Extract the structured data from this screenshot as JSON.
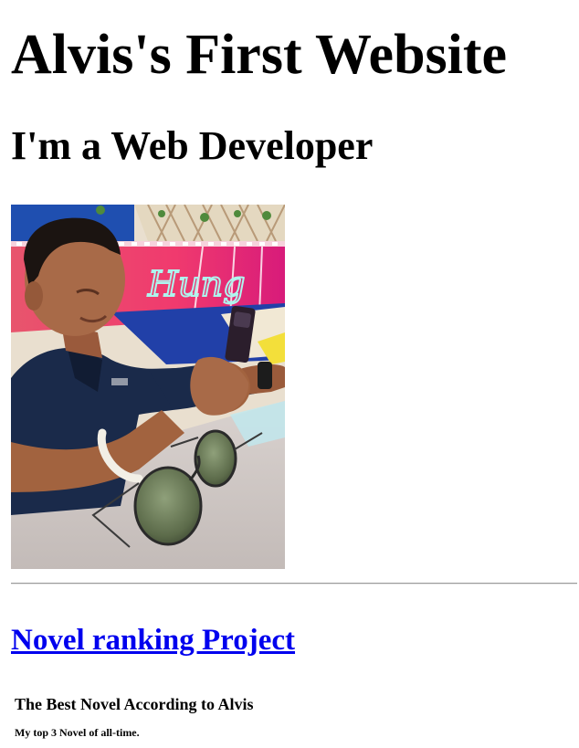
{
  "header": {
    "title": "Alvis's First Website",
    "subtitle": "I'm a Web Developer"
  },
  "photo": {
    "sign_text": "Hung"
  },
  "projects": {
    "link_label": "Novel ranking Project"
  },
  "preview": {
    "heading": "The Best Novel According to Alvis",
    "subheading": "My top 3 Novel of all-time."
  },
  "colors": {
    "link": "#0000ee",
    "text": "#000000",
    "background": "#ffffff"
  }
}
